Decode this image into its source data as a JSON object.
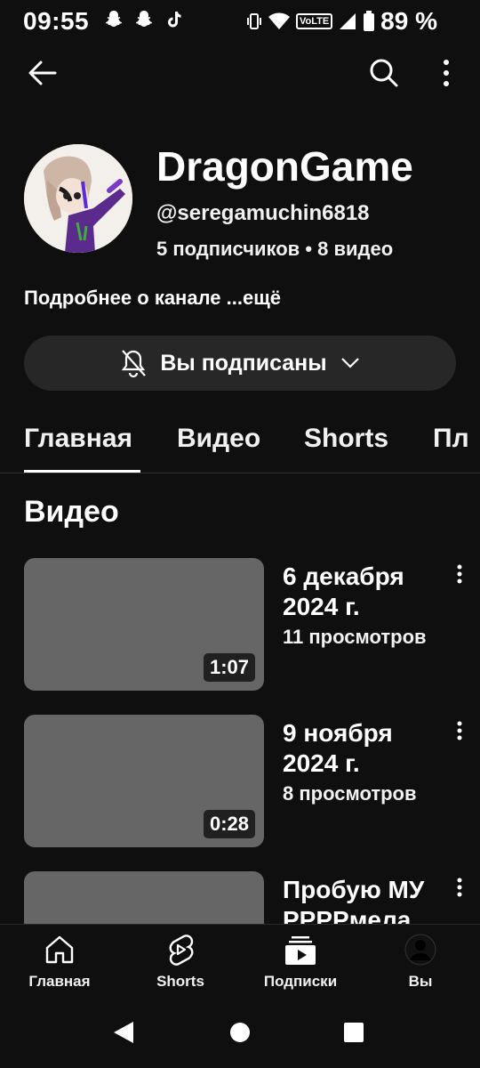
{
  "status_bar": {
    "time": "09:55",
    "network_badge": "VoLTE",
    "battery": "89 %"
  },
  "top_bar": {
    "back_icon": "arrow-left-icon",
    "search_icon": "search-icon",
    "more_icon": "more-vertical-icon"
  },
  "channel": {
    "name": "DragonGame",
    "handle": "@seregamuchin6818",
    "stats": "5 подписчиков • 8 видео",
    "about": "Подробнее о канале ...ещё",
    "subscribe_label": "Вы подписаны"
  },
  "tabs": [
    {
      "label": "Главная",
      "active": true
    },
    {
      "label": "Видео",
      "active": false
    },
    {
      "label": "Shorts",
      "active": false
    },
    {
      "label": "Пл",
      "active": false
    }
  ],
  "section_title": "Видео",
  "videos": [
    {
      "title": "6 декабря 2024 г.",
      "meta": "11 просмотров",
      "duration": "1:07"
    },
    {
      "title": "9 ноября 2024 г.",
      "meta": "8 просмотров",
      "duration": "0:28"
    },
    {
      "title": "Пробую МУ PPPPмела",
      "meta": "",
      "duration": ""
    }
  ],
  "bottom_nav": [
    {
      "label": "Главная",
      "icon": "home-icon"
    },
    {
      "label": "Shorts",
      "icon": "shorts-icon"
    },
    {
      "label": "Подписки",
      "icon": "subscriptions-icon"
    },
    {
      "label": "Вы",
      "icon": "profile-icon"
    }
  ],
  "colors": {
    "background": "#0f0f0f",
    "button_bg": "#272727",
    "thumbnail": "#666666",
    "text": "#ffffff"
  }
}
